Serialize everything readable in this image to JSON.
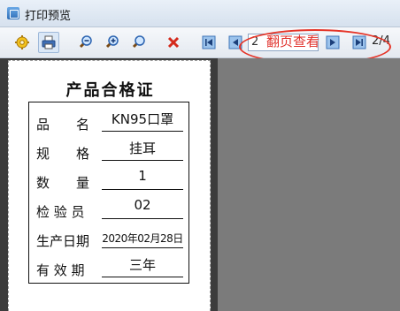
{
  "window": {
    "title": "打印预览"
  },
  "toolbar": {
    "current_page": "2",
    "flip_view_label": "翻页查看",
    "page_count": "2/4",
    "icons": [
      "settings-icon",
      "print-icon",
      "zoom-out-icon",
      "zoom-in-icon",
      "zoom-fit-icon",
      "close-icon",
      "first-page-icon",
      "prev-page-icon",
      "next-page-icon",
      "last-page-icon"
    ]
  },
  "certificate": {
    "title": "产品合格证",
    "rows": [
      {
        "label": "品　　名",
        "value": "KN95口罩"
      },
      {
        "label": "规　　格",
        "value": "挂耳"
      },
      {
        "label": "数　　量",
        "value": "1"
      },
      {
        "label": "检 验 员",
        "value": "02"
      },
      {
        "label": "生产日期",
        "value": "2020年02月28日"
      },
      {
        "label": "有 效 期",
        "value": "三年"
      }
    ]
  },
  "colors": {
    "highlight": "#e53428",
    "flip_label": "#e0302a"
  }
}
